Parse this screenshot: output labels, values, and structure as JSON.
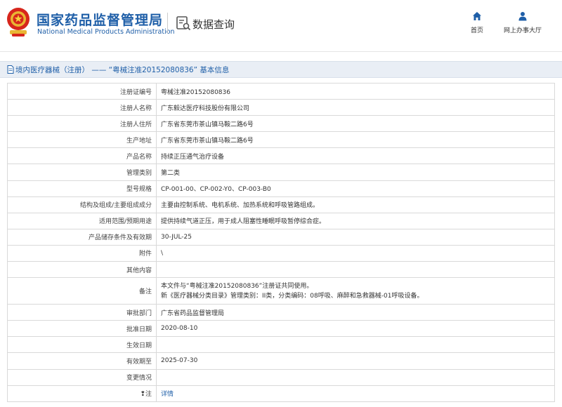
{
  "header": {
    "org_name_cn": "国家药品监督管理局",
    "org_name_en": "National Medical Products Administration",
    "query_title": "数据查询",
    "nav": [
      {
        "label": "首页",
        "icon": "home-icon"
      },
      {
        "label": "网上办事大厅",
        "icon": "user-icon"
      }
    ],
    "brand_color": "#1f5fa8"
  },
  "titlebar": {
    "section": "境内医疗器械（注册）",
    "separator": "——",
    "record": "“粤械注准20152080836”",
    "suffix": "基本信息"
  },
  "detail_rows": [
    {
      "label": "注册证编号",
      "value": "粤械注准20152080836"
    },
    {
      "label": "注册人名称",
      "value": "广东毅达医疗科技股份有限公司"
    },
    {
      "label": "注册人住所",
      "value": "广东省东莞市茶山镇马鞍二路6号"
    },
    {
      "label": "生产地址",
      "value": "广东省东莞市茶山镇马鞍二路6号"
    },
    {
      "label": "产品名称",
      "value": "持续正压通气治疗设备"
    },
    {
      "label": "管理类别",
      "value": "第二类"
    },
    {
      "label": "型号规格",
      "value": "CP-001-00、CP-002-Y0、CP-003-B0"
    },
    {
      "label": "结构及组成/主要组成成分",
      "value": "主要由控制系统、电机系统、加热系统和呼吸管路组成。"
    },
    {
      "label": "适用范围/预期用途",
      "value": "提供持续气道正压，用于成人阻塞性睡眠呼吸暂停综合症。"
    },
    {
      "label": "产品储存条件及有效期",
      "value": "30-JUL-25"
    },
    {
      "label": "附件",
      "value": "\\"
    },
    {
      "label": "其他内容",
      "value": ""
    }
  ],
  "remark_row": {
    "label": "备注",
    "line1": "本文件与“粤械注准20152080836”注册证共同使用。",
    "line2": "新《医疗器械分类目录》管理类别：II类，分类编码：08呼吸、麻醉和急救器械-01呼吸设备。"
  },
  "detail_rows_after": [
    {
      "label": "审批部门",
      "value": "广东省药品监督管理局"
    },
    {
      "label": "批准日期",
      "value": "2020-08-10"
    },
    {
      "label": "生效日期",
      "value": ""
    },
    {
      "label": "有效期至",
      "value": "2025-07-30"
    },
    {
      "label": "变更情况",
      "value": ""
    }
  ],
  "note_row": {
    "pin": "❢",
    "label": "注",
    "link": "详情"
  }
}
